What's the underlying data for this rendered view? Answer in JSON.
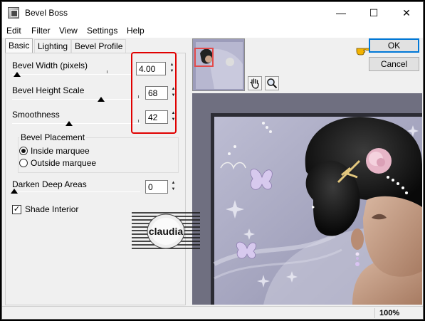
{
  "window": {
    "title": "Bevel Boss",
    "minimize_glyph": "—",
    "maximize_glyph": "☐",
    "close_glyph": "✕"
  },
  "menu": [
    "Edit",
    "Filter",
    "View",
    "Settings",
    "Help"
  ],
  "tabs": [
    {
      "label": "Basic",
      "active": true
    },
    {
      "label": "Lighting",
      "active": false
    },
    {
      "label": "Bevel Profile",
      "active": false
    }
  ],
  "controls": {
    "bevel_width": {
      "label": "Bevel Width (pixels)",
      "value": "4.00"
    },
    "bevel_height_scale": {
      "label": "Bevel Height Scale",
      "value": "68"
    },
    "smoothness": {
      "label": "Smoothness",
      "value": "42"
    },
    "darken_deep_areas": {
      "label": "Darken Deep Areas",
      "value": "0"
    }
  },
  "bevel_placement": {
    "title": "Bevel Placement",
    "options": [
      {
        "label": "Inside marquee",
        "selected": true
      },
      {
        "label": "Outside marquee",
        "selected": false
      }
    ]
  },
  "shade_interior": {
    "label": "Shade Interior",
    "checked": true,
    "glyph": "✓"
  },
  "buttons": {
    "ok": "OK",
    "cancel": "Cancel"
  },
  "status": {
    "zoom": "100%"
  },
  "watermark": {
    "text": "claudia"
  },
  "icons": {
    "hand": "hand-pan-icon",
    "zoom": "magnifier-icon",
    "pointer": "pointing-hand-icon"
  },
  "colors": {
    "highlight_red": "#e00000",
    "pointer_yellow": "#f2b200",
    "default_button_border": "#0078d7"
  }
}
